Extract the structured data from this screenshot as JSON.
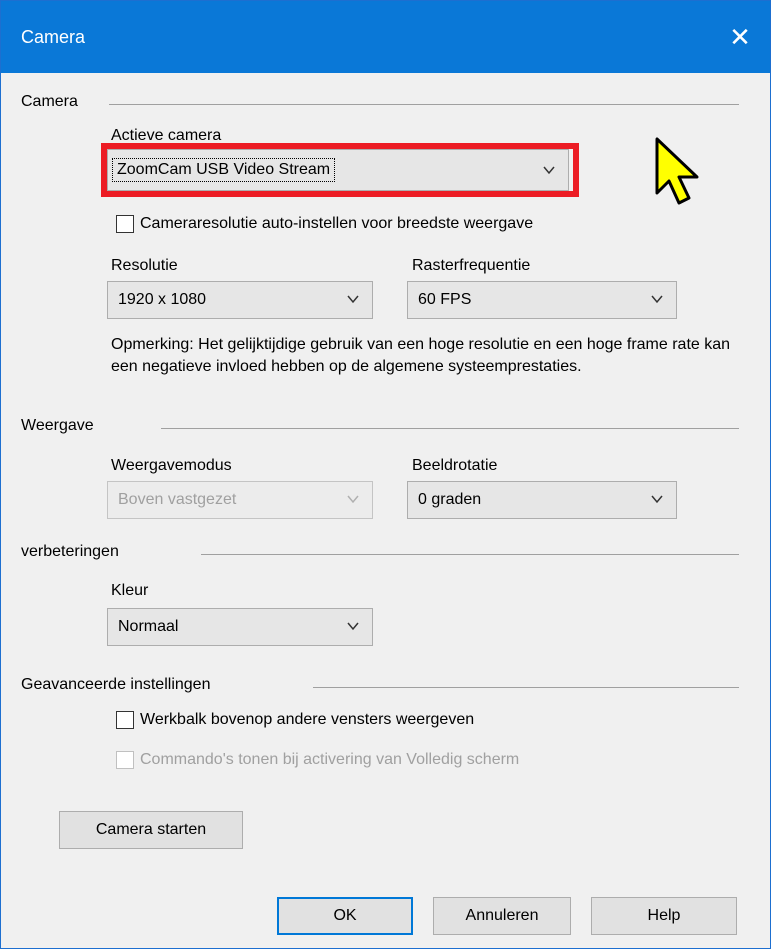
{
  "window": {
    "title": "Camera"
  },
  "camera": {
    "section_label": "Camera",
    "active_label": "Actieve camera",
    "active_value": "ZoomCam USB Video Stream",
    "auto_res_label": "Cameraresolutie auto-instellen voor breedste weergave",
    "auto_res_checked": false,
    "resolution_label": "Resolutie",
    "resolution_value": "1920 x 1080",
    "framerate_label": "Rasterfrequentie",
    "framerate_value": "60 FPS",
    "note": "Opmerking: Het gelijktijdige gebruik van een hoge resolutie en een hoge frame rate kan een negatieve invloed hebben op de algemene systeemprestaties."
  },
  "display": {
    "section_label": "Weergave",
    "mode_label": "Weergavemodus",
    "mode_value": "Boven vastgezet",
    "rotation_label": "Beeldrotatie",
    "rotation_value": "0 graden"
  },
  "enhancements": {
    "section_label": "verbeteringen",
    "color_label": "Kleur",
    "color_value": "Normaal"
  },
  "advanced": {
    "section_label": "Geavanceerde instellingen",
    "toolbar_label": "Werkbalk bovenop andere vensters weergeven",
    "toolbar_checked": false,
    "fullscreen_cmd_label": "Commando's tonen bij activering van Volledig scherm",
    "fullscreen_cmd_checked": false
  },
  "buttons": {
    "start_camera": "Camera starten",
    "ok": "OK",
    "cancel": "Annuleren",
    "help": "Help"
  },
  "colors": {
    "titlebar": "#0a78d7",
    "highlight": "#ec1c24",
    "cursor": "#ffff00"
  }
}
